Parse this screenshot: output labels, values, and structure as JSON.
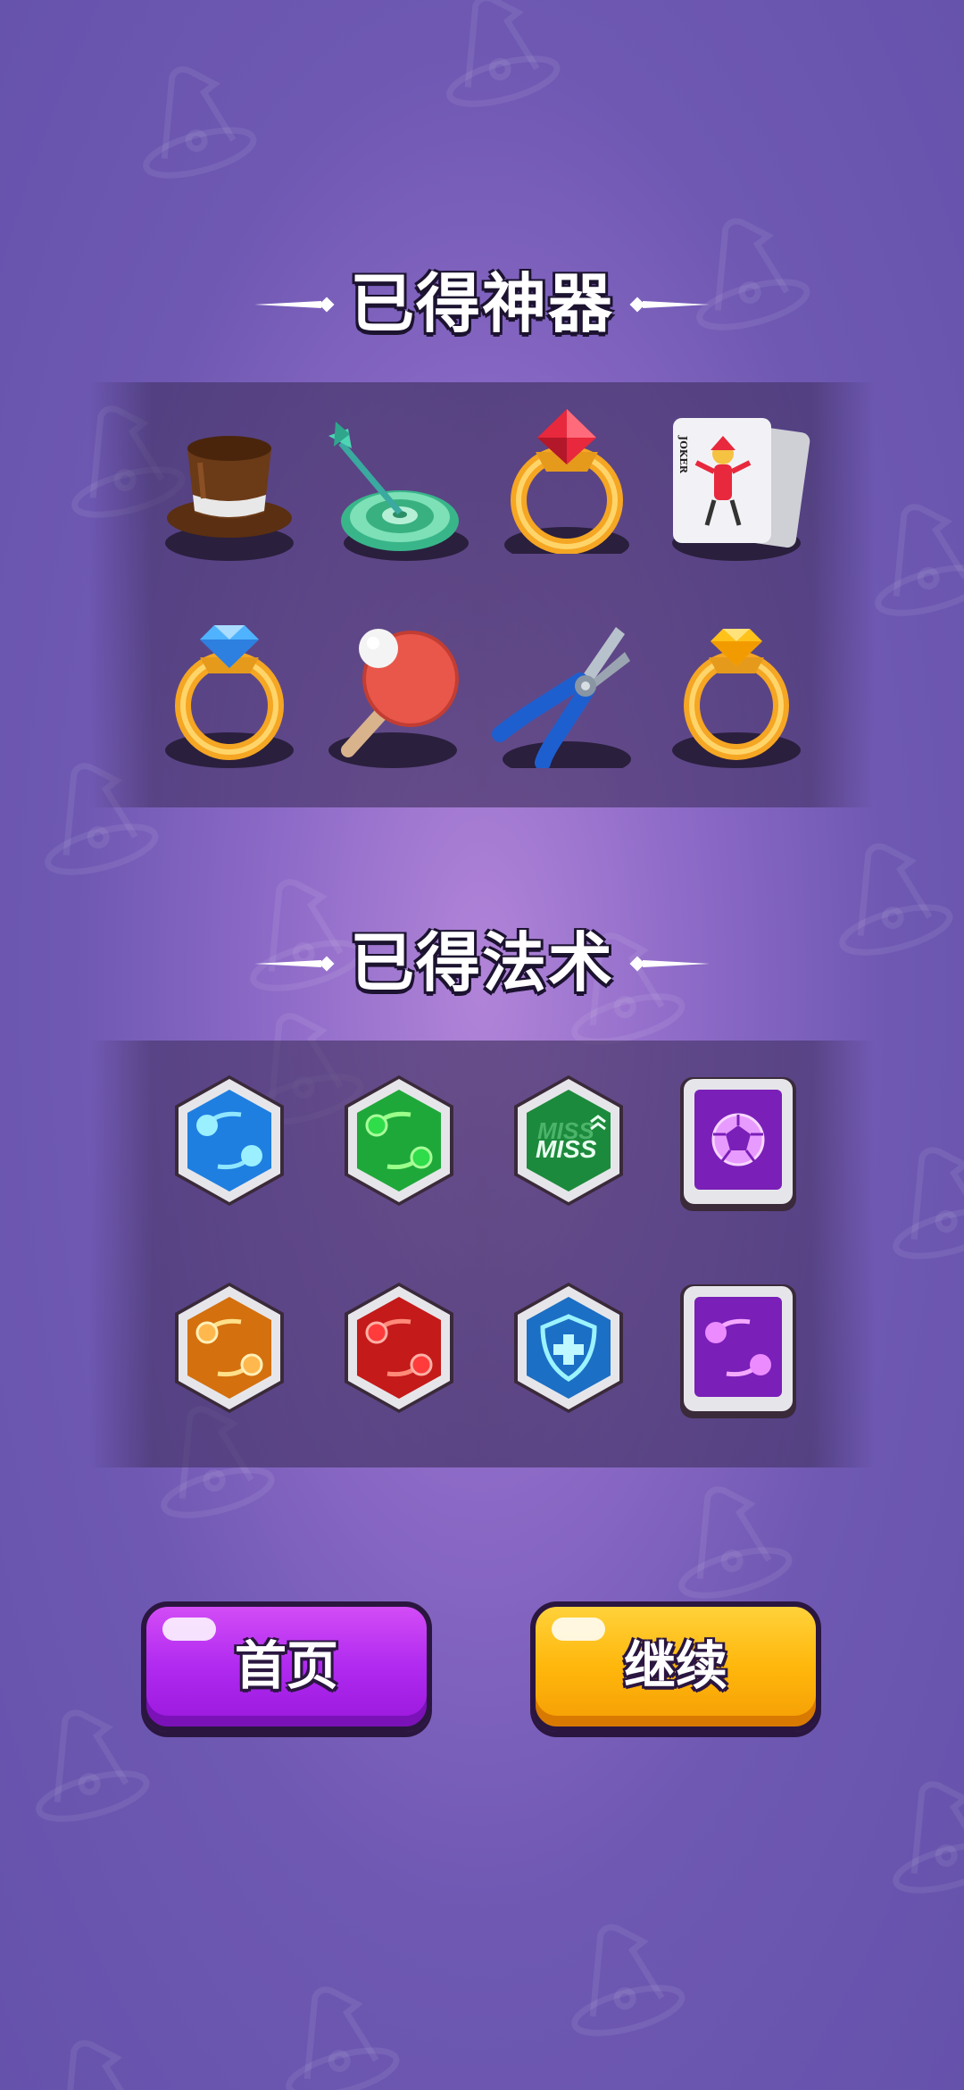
{
  "theme": {
    "accent_purple": "#b02af0",
    "accent_orange": "#ffb70c",
    "background": "#6f58b2"
  },
  "artifacts_section": {
    "title": "已得神器",
    "items": [
      {
        "icon": "top-hat-icon"
      },
      {
        "icon": "dart-target-icon"
      },
      {
        "icon": "ruby-ring-icon"
      },
      {
        "icon": "joker-card-icon",
        "card_text": "JOKER"
      },
      {
        "icon": "diamond-ring-icon"
      },
      {
        "icon": "ping-pong-paddle-icon"
      },
      {
        "icon": "pliers-icon"
      },
      {
        "icon": "topaz-ring-icon"
      }
    ]
  },
  "spells_section": {
    "title": "已得法术",
    "items": [
      {
        "icon": "blue-swap-spell-icon",
        "color": "#1e7fe0"
      },
      {
        "icon": "green-swap-spell-icon",
        "color": "#1fa83a"
      },
      {
        "icon": "miss-spell-icon",
        "color": "#1c8a3c",
        "label": "MISS"
      },
      {
        "icon": "purple-shell-spell-icon",
        "color": "#7a1fb8"
      },
      {
        "icon": "orange-swap-spell-icon",
        "color": "#d4700e"
      },
      {
        "icon": "red-swap-spell-icon",
        "color": "#c41a1a"
      },
      {
        "icon": "shield-heal-spell-icon",
        "color": "#1b6fc4"
      },
      {
        "icon": "purple-swap-spell-icon",
        "color": "#7a1fb8"
      }
    ]
  },
  "buttons": {
    "home": "首页",
    "continue": "继续"
  }
}
